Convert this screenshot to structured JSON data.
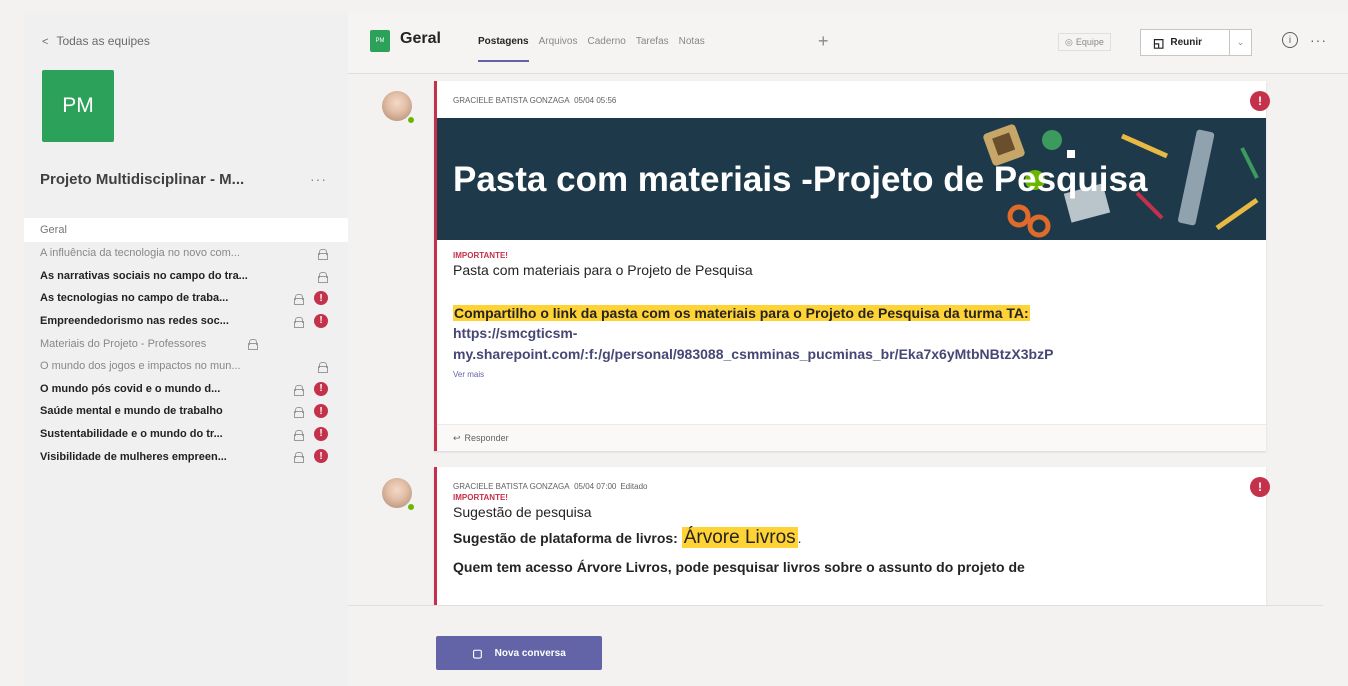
{
  "sidebar": {
    "back_label": "Todas as equipes",
    "team_initials": "PM",
    "team_name": "Projeto Multidisciplinar - M...",
    "channels": [
      {
        "label": "Geral",
        "active": true,
        "bold": false,
        "lock": false,
        "alert": false
      },
      {
        "label": "A influência da tecnologia no novo com...",
        "active": false,
        "bold": false,
        "lock": true,
        "alert": false
      },
      {
        "label": "As narrativas sociais no campo do tra...",
        "active": false,
        "bold": true,
        "lock": true,
        "alert": false
      },
      {
        "label": "As tecnologias no campo de traba...",
        "active": false,
        "bold": true,
        "lock": true,
        "alert": true
      },
      {
        "label": "Empreendedorismo nas redes soc...",
        "active": false,
        "bold": true,
        "lock": true,
        "alert": true
      },
      {
        "label": "Materiais do Projeto - Professores",
        "active": false,
        "bold": false,
        "lock": true,
        "alert": false
      },
      {
        "label": "O mundo dos jogos e impactos no mun...",
        "active": false,
        "bold": false,
        "lock": true,
        "alert": false
      },
      {
        "label": "O mundo pós covid e o mundo d...",
        "active": false,
        "bold": true,
        "lock": true,
        "alert": true
      },
      {
        "label": "Saúde mental e mundo de trabalho",
        "active": false,
        "bold": true,
        "lock": true,
        "alert": true
      },
      {
        "label": "Sustentabilidade e o mundo do tr...",
        "active": false,
        "bold": true,
        "lock": true,
        "alert": true
      },
      {
        "label": "Visibilidade de mulheres empreen...",
        "active": false,
        "bold": true,
        "lock": true,
        "alert": true
      }
    ]
  },
  "header": {
    "avatar_initials": "PM",
    "title": "Geral",
    "tabs": [
      "Postagens",
      "Arquivos",
      "Caderno",
      "Tarefas",
      "Notas"
    ],
    "add_tab": "+",
    "team_button": "Equipe",
    "meet_button": "Reunir",
    "dropdown": "⌄",
    "info": "i",
    "more": "···"
  },
  "posts": [
    {
      "author": "GRACIELE BATISTA GONZAGA",
      "time": "05/04 05:56",
      "edited": "",
      "banner_title": "Pasta com materiais -Projeto de Pesquisa",
      "important_label": "IMPORTANTE!",
      "subject": "Pasta com materiais para o Projeto de Pesquisa",
      "highlight": "Compartilho o link da pasta com os materiais para o Projeto de Pesquisa da turma TA:",
      "link_line1": "https://smcgticsm-",
      "link_line2": "my.sharepoint.com/:f:/g/personal/983088_csmminas_pucminas_br/Eka7x6yMtbNBtzX3bzP",
      "see_more": "Ver mais",
      "reply": "Responder"
    },
    {
      "author": "GRACIELE BATISTA GONZAGA",
      "time": "05/04 07:00",
      "edited": "Editado",
      "important_label": "IMPORTANTE!",
      "subject": "Sugestão de pesquisa",
      "line1_prefix": "Sugestão de plataforma de livros:",
      "line1_highlight": "Árvore Livros",
      "line1_suffix": ".",
      "line2": "Quem tem acesso Árvore Livros, pode pesquisar livros sobre o assunto do projeto de"
    }
  ],
  "new_conversation": "Nova conversa",
  "colors": {
    "accent": "#6264a7",
    "team_green": "#2ba15a",
    "important_red": "#c4314b",
    "highlight_yellow": "#ffd335",
    "banner_bg": "#1e3a4a"
  }
}
